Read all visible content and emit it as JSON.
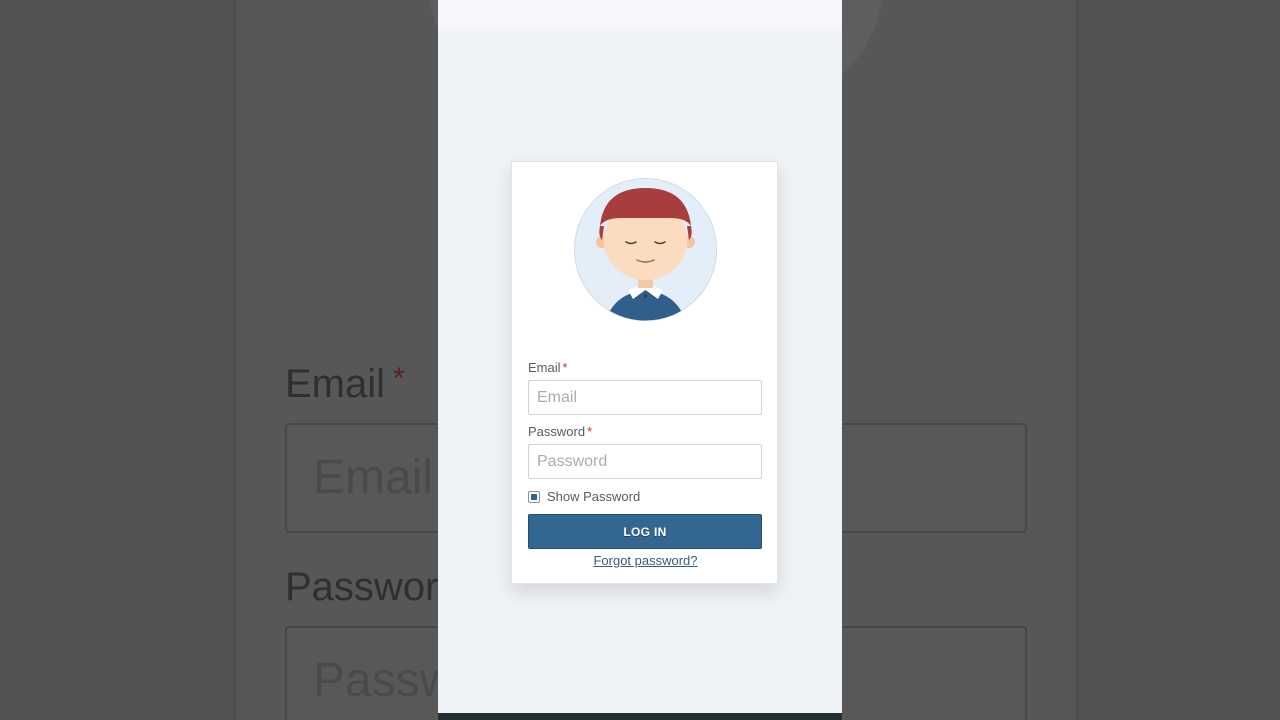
{
  "background": {
    "email_label": "Email",
    "email_placeholder": "Email",
    "password_label": "Passwor",
    "password_placeholder": "Passw",
    "required_marker": "*"
  },
  "form": {
    "email_label": "Email",
    "email_placeholder": "Email",
    "email_value": "",
    "password_label": "Password",
    "password_placeholder": "Password",
    "password_value": "",
    "required_marker": "*",
    "show_password_label": "Show Password",
    "show_password_checked": true,
    "login_button_label": "LOG IN",
    "forgot_password_link": "Forgot password?"
  },
  "avatar": {
    "icon": "user-avatar-icon"
  },
  "colors": {
    "primary_button": "#336791",
    "required_marker": "#c0392b",
    "link": "#3b5b7a",
    "page_background": "#f0f3f6",
    "avatar_hair": "#a83d3d",
    "avatar_shirt": "#2f5f8a"
  }
}
